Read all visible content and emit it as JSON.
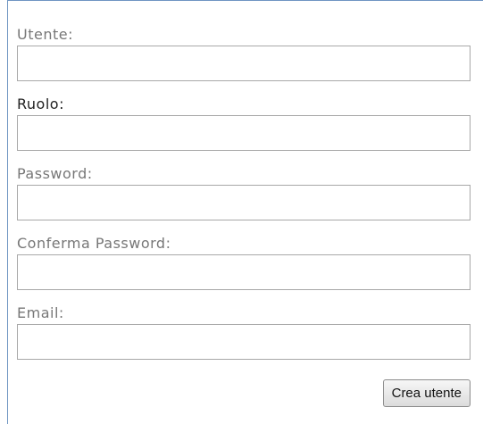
{
  "form": {
    "fields": [
      {
        "label": "Utente:",
        "value": ""
      },
      {
        "label": "Ruolo:",
        "value": ""
      },
      {
        "label": "Password:",
        "value": ""
      },
      {
        "label": "Conferma Password:",
        "value": ""
      },
      {
        "label": "Email:",
        "value": ""
      }
    ],
    "submit_label": "Crea utente"
  },
  "colors": {
    "panel_border": "#6f95c2",
    "label_text": "#777777",
    "label_text_dark": "#222222",
    "input_border": "#a8a8a8"
  }
}
